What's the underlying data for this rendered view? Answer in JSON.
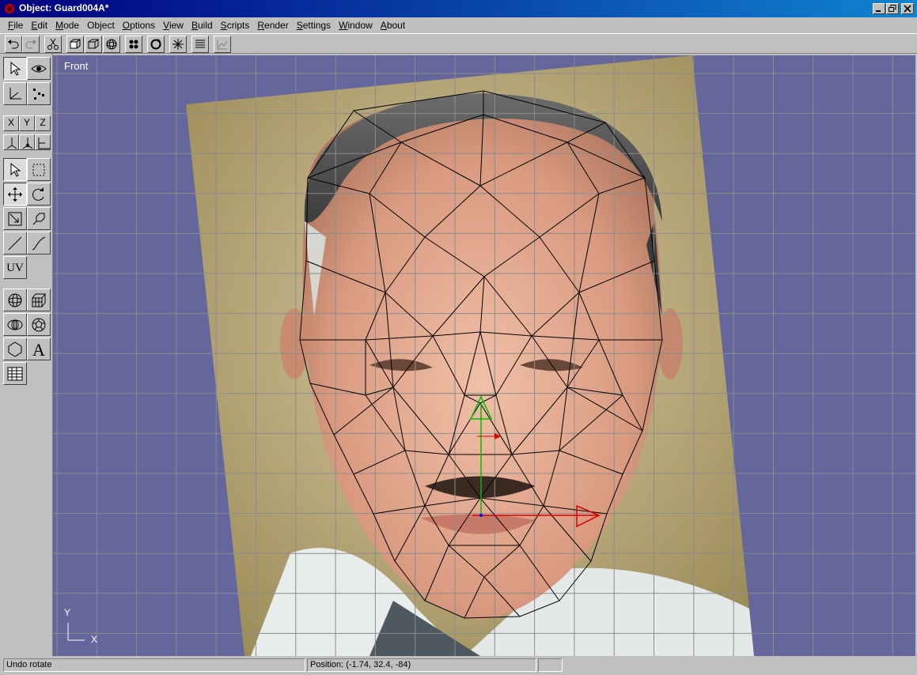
{
  "window": {
    "title": "Object: Guard004A*"
  },
  "menu": [
    {
      "pre": "",
      "key": "F",
      "post": "ile"
    },
    {
      "pre": "",
      "key": "E",
      "post": "dit"
    },
    {
      "pre": "",
      "key": "M",
      "post": "ode"
    },
    {
      "pre": "",
      "key": "",
      "post": "Object"
    },
    {
      "pre": "",
      "key": "O",
      "post": "ptions"
    },
    {
      "pre": "",
      "key": "V",
      "post": "iew"
    },
    {
      "pre": "",
      "key": "B",
      "post": "uild"
    },
    {
      "pre": "",
      "key": "S",
      "post": "cripts"
    },
    {
      "pre": "",
      "key": "R",
      "post": "ender"
    },
    {
      "pre": "",
      "key": "S",
      "post": "ettings"
    },
    {
      "pre": "",
      "key": "W",
      "post": "indow"
    },
    {
      "pre": "",
      "key": "A",
      "post": "bout"
    }
  ],
  "toolbar": {
    "buttons": [
      "undo-icon",
      "redo-icon",
      "cut-icon",
      "wire-cube-icon",
      "solid-cube-icon",
      "sphere-icon",
      "vertices-icon",
      "rotate-view-icon",
      "sparkle-icon",
      "list-icon",
      "graph-icon"
    ]
  },
  "tools": {
    "axis_x": "X",
    "axis_y": "Y",
    "axis_z": "Z",
    "uv_label": "UV",
    "text_label": "A",
    "icons": [
      "select-arrow-icon",
      "eye-icon",
      "axes-icon",
      "points-icon",
      "box-select-icon",
      "move-icon",
      "rotate-icon",
      "scale-icon",
      "stretch-icon",
      "line-icon",
      "curve-icon",
      "sphere-primitive-icon",
      "grid-box-icon",
      "torus-icon",
      "geodesic-icon",
      "hexagon-icon",
      "spreadsheet-icon"
    ]
  },
  "viewport": {
    "view_name": "Front",
    "axis_y_label": "Y",
    "axis_x_label": "X",
    "background_color": "#65669c",
    "grid_color": "#8c8c8c"
  },
  "status": {
    "message": "Undo rotate",
    "position": "Position: (-1.74, 32.4, -84)",
    "extra": ""
  }
}
